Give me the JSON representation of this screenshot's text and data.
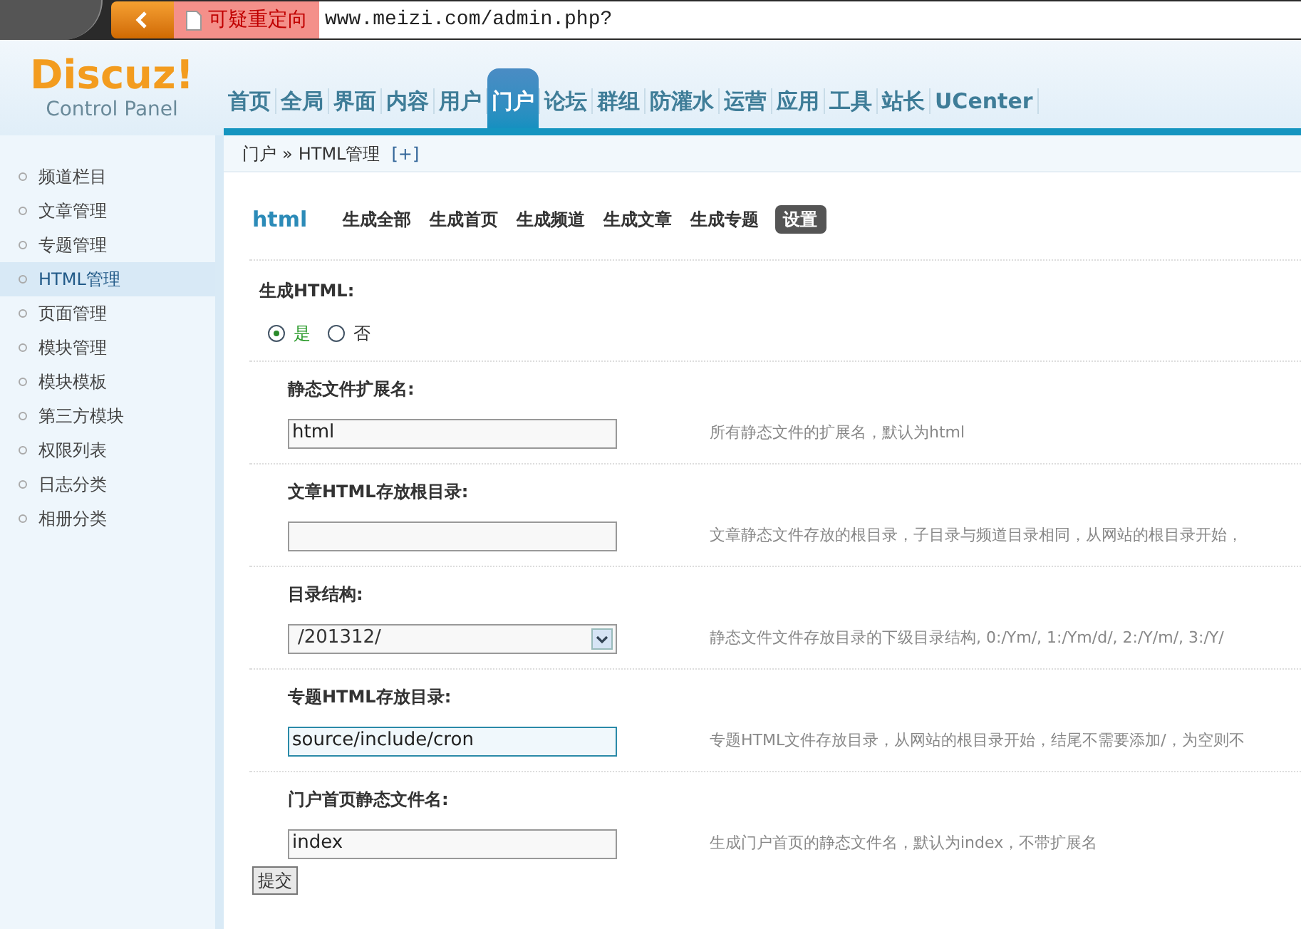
{
  "browser": {
    "security_label": "可疑重定向",
    "url": "www.meizi.com/admin.php?"
  },
  "logo": {
    "brand": "Discuz!",
    "subtitle": "Control Panel"
  },
  "nav": [
    {
      "label": "首页",
      "selected": false
    },
    {
      "label": "全局",
      "selected": false
    },
    {
      "label": "界面",
      "selected": false
    },
    {
      "label": "内容",
      "selected": false
    },
    {
      "label": "用户",
      "selected": false
    },
    {
      "label": "门户",
      "selected": true
    },
    {
      "label": "论坛",
      "selected": false
    },
    {
      "label": "群组",
      "selected": false
    },
    {
      "label": "防灌水",
      "selected": false
    },
    {
      "label": "运营",
      "selected": false
    },
    {
      "label": "应用",
      "selected": false
    },
    {
      "label": "工具",
      "selected": false
    },
    {
      "label": "站长",
      "selected": false
    },
    {
      "label": "UCenter",
      "selected": false
    }
  ],
  "breadcrumb": {
    "parent": "门户",
    "separator": "»",
    "current": "HTML管理",
    "add": "[+]"
  },
  "sidebar": {
    "items": [
      {
        "label": "频道栏目",
        "selected": false
      },
      {
        "label": "文章管理",
        "selected": false
      },
      {
        "label": "专题管理",
        "selected": false
      },
      {
        "label": "HTML管理",
        "selected": true
      },
      {
        "label": "页面管理",
        "selected": false
      },
      {
        "label": "模块管理",
        "selected": false
      },
      {
        "label": "模块模板",
        "selected": false
      },
      {
        "label": "第三方模块",
        "selected": false
      },
      {
        "label": "权限列表",
        "selected": false
      },
      {
        "label": "日志分类",
        "selected": false
      },
      {
        "label": "相册分类",
        "selected": false
      }
    ]
  },
  "toolbar": {
    "title": "html",
    "tabs": [
      {
        "label": "生成全部",
        "selected": false
      },
      {
        "label": "生成首页",
        "selected": false
      },
      {
        "label": "生成频道",
        "selected": false
      },
      {
        "label": "生成文章",
        "selected": false
      },
      {
        "label": "生成专题",
        "selected": false
      },
      {
        "label": "设置",
        "selected": true
      }
    ]
  },
  "generate_html": {
    "label": "生成HTML:",
    "options": [
      {
        "label": "是",
        "selected": true
      },
      {
        "label": "否",
        "selected": false
      }
    ]
  },
  "fields": [
    {
      "kind": "input",
      "label": "静态文件扩展名:",
      "value": "html",
      "focused": false,
      "description": "所有静态文件的扩展名，默认为html"
    },
    {
      "kind": "input",
      "label": "文章HTML存放根目录:",
      "focused": false,
      "description": "文章静态文件存放的根目录，子目录与频道目录相同，从网站的根目录开始，"
    },
    {
      "kind": "select",
      "label": "目录结构:",
      "value": "/201312/",
      "description": "静态文件文件存放目录的下级目录结构, 0:/Ym/, 1:/Ym/d/, 2:/Y/m/, 3:/Y/"
    },
    {
      "kind": "input",
      "label": "专题HTML存放目录:",
      "value": "source/include/cron",
      "focused": true,
      "description": "专题HTML文件存放目录，从网站的根目录开始，结尾不需要添加/，为空则不"
    },
    {
      "kind": "input",
      "label": "门户首页静态文件名:",
      "value": "index",
      "focused": false,
      "description": "生成门户首页的静态文件名，默认为index，不带扩展名"
    }
  ],
  "submit": "提交"
}
